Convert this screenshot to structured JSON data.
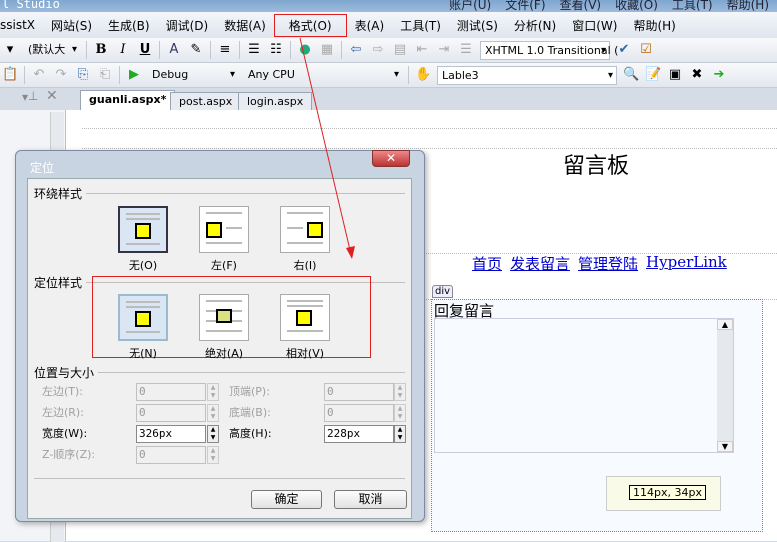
{
  "window": {
    "title": "l Studio",
    "right_menu": [
      "账户(U)",
      "文件(F)",
      "查看(V)",
      "收藏(O)",
      "工具(T)",
      "帮助(H)"
    ]
  },
  "menubar": [
    "ssistX",
    "网站(S)",
    "生成(B)",
    "调试(D)",
    "数据(A)",
    "格式(O)",
    "表(A)",
    "工具(T)",
    "测试(S)",
    "分析(N)",
    "窗口(W)",
    "帮助(H)"
  ],
  "toolbar1": {
    "font_size": "(默认大",
    "bold": "B",
    "italic": "I",
    "underline": "U",
    "doctype": "XHTML 1.0 Transitional ("
  },
  "toolbar2": {
    "config": "Debug",
    "platform": "Any CPU",
    "target": "Lable3"
  },
  "tabs": [
    "guanli.aspx*",
    "post.aspx",
    "login.aspx"
  ],
  "dialog": {
    "title": "定位",
    "wrap_section": "环绕样式",
    "wrap_options": [
      "无(O)",
      "左(F)",
      "右(I)"
    ],
    "position_section": "定位样式",
    "position_options": [
      "无(N)",
      "绝对(A)",
      "相对(V)"
    ],
    "size_section": "位置与大小",
    "fields": {
      "left": {
        "label": "左边(T):",
        "value": "0"
      },
      "top": {
        "label": "顶端(P):",
        "value": "0"
      },
      "right": {
        "label": "左边(R):",
        "value": "0"
      },
      "bottom": {
        "label": "底端(B):",
        "value": "0"
      },
      "width": {
        "label": "宽度(W):",
        "value": "326px"
      },
      "height": {
        "label": "高度(H):",
        "value": "228px"
      },
      "z": {
        "label": "Z-顺序(Z):",
        "value": "0"
      }
    },
    "ok": "确定",
    "cancel": "取消"
  },
  "page": {
    "heading": "留言板",
    "links": [
      "首页",
      "发表留言",
      "管理登陆",
      "HyperLink"
    ],
    "div_tag": "div",
    "reply_label": "回复留言",
    "size_tooltip": "114px, 34px"
  },
  "colors": {
    "annotation": "#e02020",
    "highlight": "#ffff00"
  }
}
